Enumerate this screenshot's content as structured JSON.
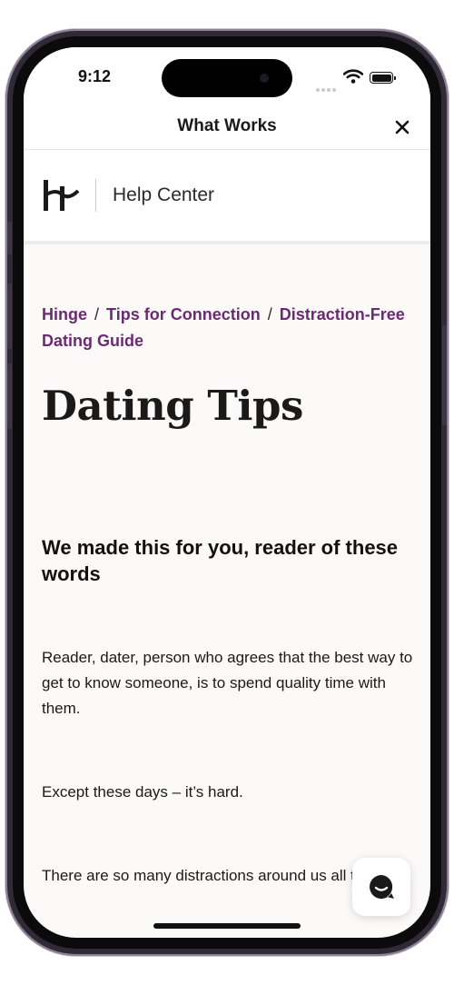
{
  "status_bar": {
    "time": "9:12"
  },
  "navbar": {
    "title": "What Works",
    "close_icon": "close-icon"
  },
  "help_center": {
    "logo_icon": "hinge-logo-icon",
    "title": "Help Center"
  },
  "breadcrumb": [
    {
      "label": "Hinge"
    },
    {
      "label": "Tips for Connection"
    },
    {
      "label": "Distraction-Free Dating Guide"
    }
  ],
  "article": {
    "title": "Dating Tips",
    "subheading": "We made this for you, reader of these words",
    "paragraphs": [
      "Reader, dater, person who agrees that the best way to get to know someone, is to spend quality time with them.",
      "Except these days – it’s hard.",
      "There are so many distractions around us all the time."
    ]
  },
  "chat_widget": {
    "icon": "chat-bubble-icon"
  },
  "colors": {
    "link": "#6b2a73",
    "background": "#fbfaf8",
    "text": "#1a1a1a"
  }
}
